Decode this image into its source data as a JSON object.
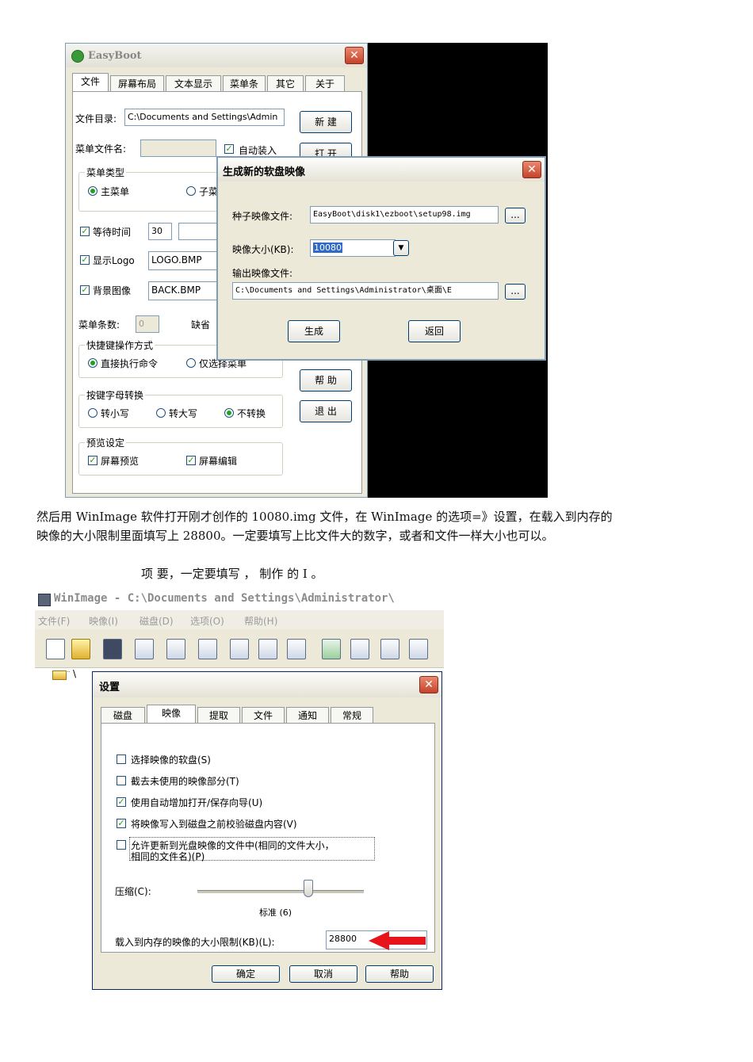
{
  "easyboot": {
    "title": "EasyBoot",
    "tabs": [
      "文件",
      "屏幕布局",
      "文本显示",
      "菜单条",
      "其它",
      "关于"
    ],
    "file_dir_label": "文件目录:",
    "file_dir_value": "C:\\Documents and Settings\\Admin",
    "new_button": "新  建",
    "menu_file_label": "菜单文件名:",
    "menu_file_value": "",
    "auto_load_label": "自动装入",
    "open_button": "打  开",
    "menu_type_legend": "菜单类型",
    "main_menu_label": "主菜单",
    "sub_menu_label": "子菜",
    "wait_time_label": "等待时间",
    "wait_time_value": "30",
    "show_logo_label": "显示Logo",
    "logo_value": "LOGO.BMP",
    "bg_image_label": "背景图像",
    "bg_value": "BACK.BMP",
    "menu_count_label": "菜单条数:",
    "menu_count_value": "0",
    "default_label": "缺省",
    "hotkey_legend": "快捷键操作方式",
    "exec_label": "直接执行命令",
    "select_only_label": "仅选择菜单",
    "help_button": "帮  助",
    "case_legend": "按键字母转换",
    "lower_label": "转小写",
    "upper_label": "转大写",
    "no_convert_label": "不转换",
    "exit_button": "退  出",
    "preview_legend": "预览设定",
    "screen_preview_label": "屏幕预览",
    "screen_edit_label": "屏幕编辑"
  },
  "generate_dialog": {
    "title": "生成新的软盘映像",
    "seed_label": "种子映像文件:",
    "seed_value": "EasyBoot\\disk1\\ezboot\\setup98.img",
    "size_label": "映像大小(KB):",
    "size_value": "10080",
    "output_label": "输出映像文件:",
    "output_value": "C:\\Documents and Settings\\Administrator\\桌面\\E",
    "browse_label": "...",
    "generate_button": "生成",
    "back_button": "返回"
  },
  "paragraph": {
    "line1": "然后用 WinImage 软件打开刚才创作的 10080.img 文件，在 WinImage 的选项=》设置，在载入到内存的",
    "line2": "映像的大小限制里面填写上 28800。一定要填写上比文件大的数字，或者和文件一样大小也可以。",
    "line3": "项     要，一定要填写   ，       制作    的 I               。"
  },
  "winimage": {
    "title": "WinImage - C:\\Documents and Settings\\Administrator\\",
    "menu": [
      "文件(F)",
      "映像(I)",
      "磁盘(D)",
      "选项(O)",
      "帮助(H)"
    ],
    "tree_root": "\\"
  },
  "settings_dialog": {
    "title": "设置",
    "tabs": [
      "磁盘",
      "映像",
      "提取",
      "文件",
      "通知",
      "常规"
    ],
    "options": [
      {
        "label": "选择映像的软盘(S)",
        "checked": false
      },
      {
        "label": "截去未使用的映像部分(T)",
        "checked": false
      },
      {
        "label": "使用自动增加打开/保存向导(U)",
        "checked": true
      },
      {
        "label": "将映像写入到磁盘之前校验磁盘内容(V)",
        "checked": true
      }
    ],
    "allow_update_line1": "允许更新到光盘映像的文件中(相同的文件大小，",
    "allow_update_line2": "相同的文件名)(P)",
    "compress_label": "压缩(C):",
    "compress_value_label": "标准 (6)",
    "compress_level": 6,
    "compress_max": 9,
    "mem_limit_label": "载入到内存的映像的大小限制(KB)(L):",
    "mem_limit_value": "28800",
    "ok_button": "确定",
    "cancel_button": "取消",
    "help_button": "帮助",
    "arrow_color": "#e8141c"
  }
}
